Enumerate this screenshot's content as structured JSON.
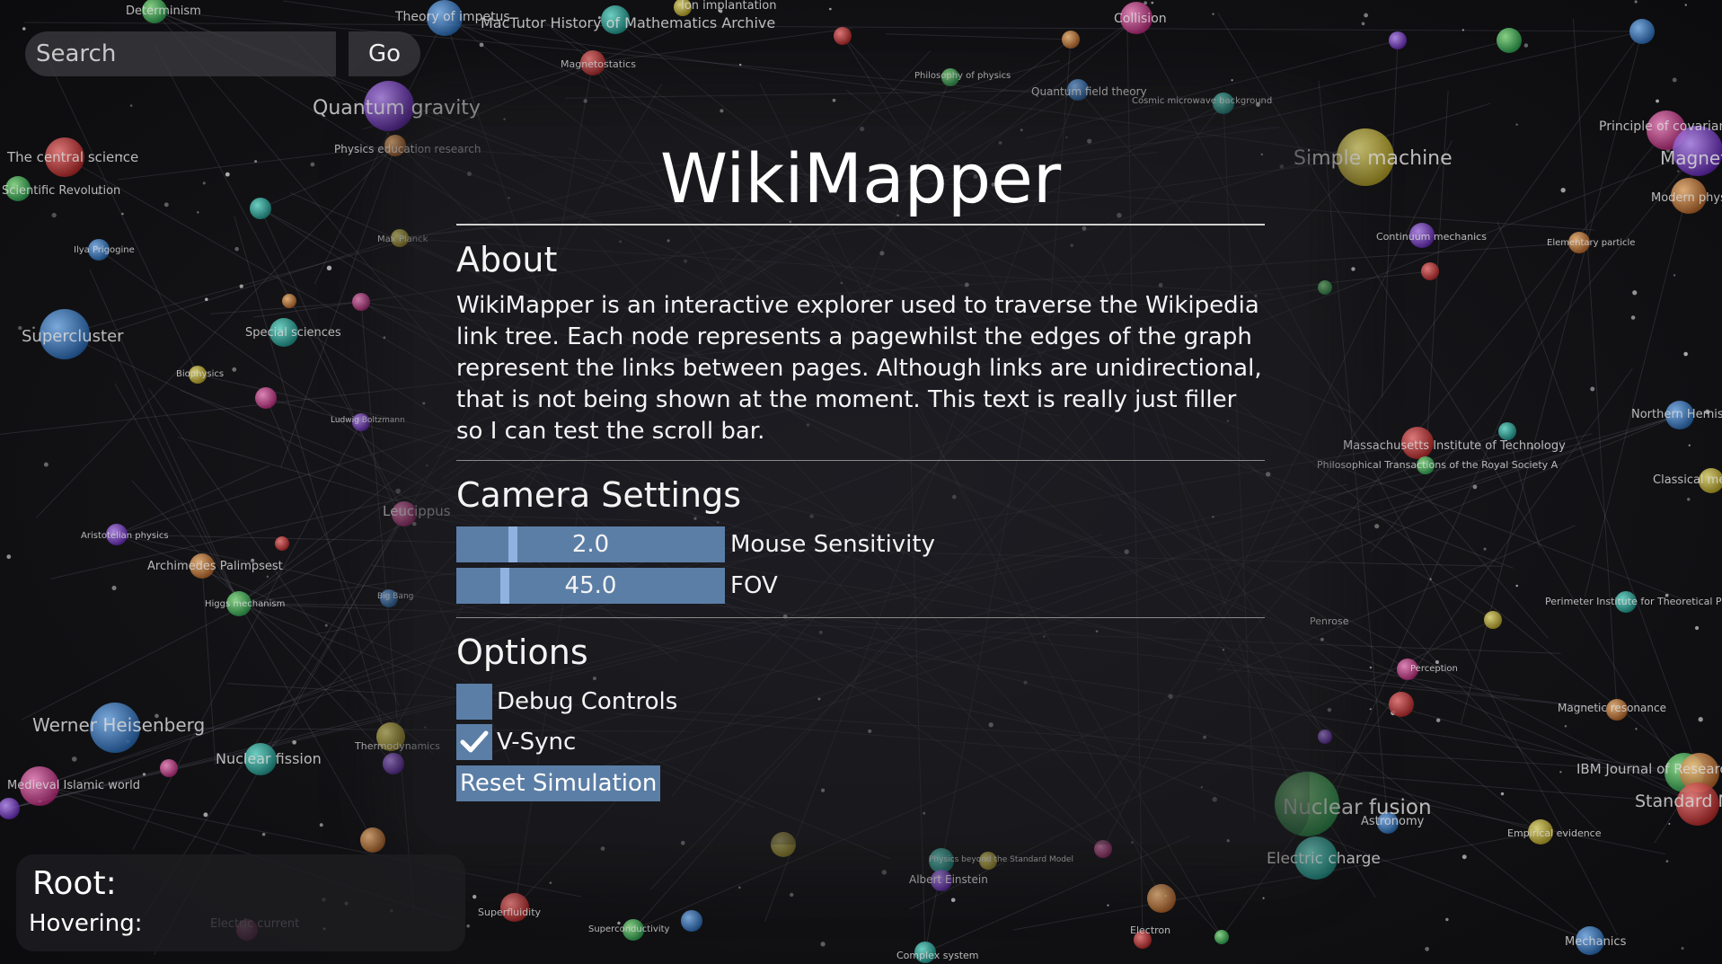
{
  "search": {
    "placeholder": "Search",
    "go_label": "Go"
  },
  "panel": {
    "title": "WikiMapper",
    "about": {
      "heading": "About",
      "text": "WikiMapper is an interactive explorer used to traverse the Wikipedia link tree. Each node represents a pagewhilst the edges of the graph represent the links between pages. Although links are unidirectional, that is not being shown at the moment. This text is really just filler so I can test the scroll bar."
    },
    "camera": {
      "heading": "Camera Settings",
      "sliders": [
        {
          "label": "Mouse Sensitivity",
          "value": "2.0",
          "fraction": 0.21
        },
        {
          "label": "FOV",
          "value": "45.0",
          "fraction": 0.18
        }
      ]
    },
    "options": {
      "heading": "Options",
      "checkboxes": [
        {
          "label": "Debug Controls",
          "checked": false
        },
        {
          "label": "V-Sync",
          "checked": true
        }
      ],
      "reset_label": "Reset Simulation"
    }
  },
  "info": {
    "root_label": "Root:",
    "hover_label": "Hovering:"
  },
  "node_labels": [
    "Determinism",
    "Theory of impetus",
    "MacTutor History of Mathematics Archive",
    "Ion implantation",
    "Collision",
    "Quantum gravity",
    "Physics education research",
    "Magnetostatics",
    "Philosophy of physics",
    "Quantum field theory",
    "Cosmic microwave background",
    "Simple machine",
    "Principle of covariance",
    "Magnetism",
    "Modern physics",
    "The central science",
    "Scientific Revolution",
    "Ilya Prigogine",
    "Continuum mechanics",
    "Elementary particle",
    "Supercluster",
    "Special sciences",
    "Biophysics",
    "Ludwig Boltzmann",
    "Northern Hemisphere",
    "Massachusetts Institute of Technology",
    "Philosophical Transactions of the Royal Society A",
    "Classical mechanics",
    "Aristotelian physics",
    "Archimedes Palimpsest",
    "Higgs mechanism",
    "Perimeter Institute for Theoretical Physics",
    "Penrose",
    "Perception",
    "Magnetic resonance",
    "Werner Heisenberg",
    "Nuclear fission",
    "Thermodynamics",
    "Medieval Islamic world",
    "IBM Journal of Research and Development",
    "Standard Model",
    "Nuclear fusion",
    "Astronomy",
    "Electric charge",
    "Empirical evidence",
    "Superfluidity",
    "Albert Einstein",
    "Superconductivity",
    "Mechanics",
    "Complex system",
    "Physics beyond the Standard Model",
    "Leucippus",
    "Max Planck",
    "Big Bang",
    "Electron",
    "Electric current"
  ]
}
